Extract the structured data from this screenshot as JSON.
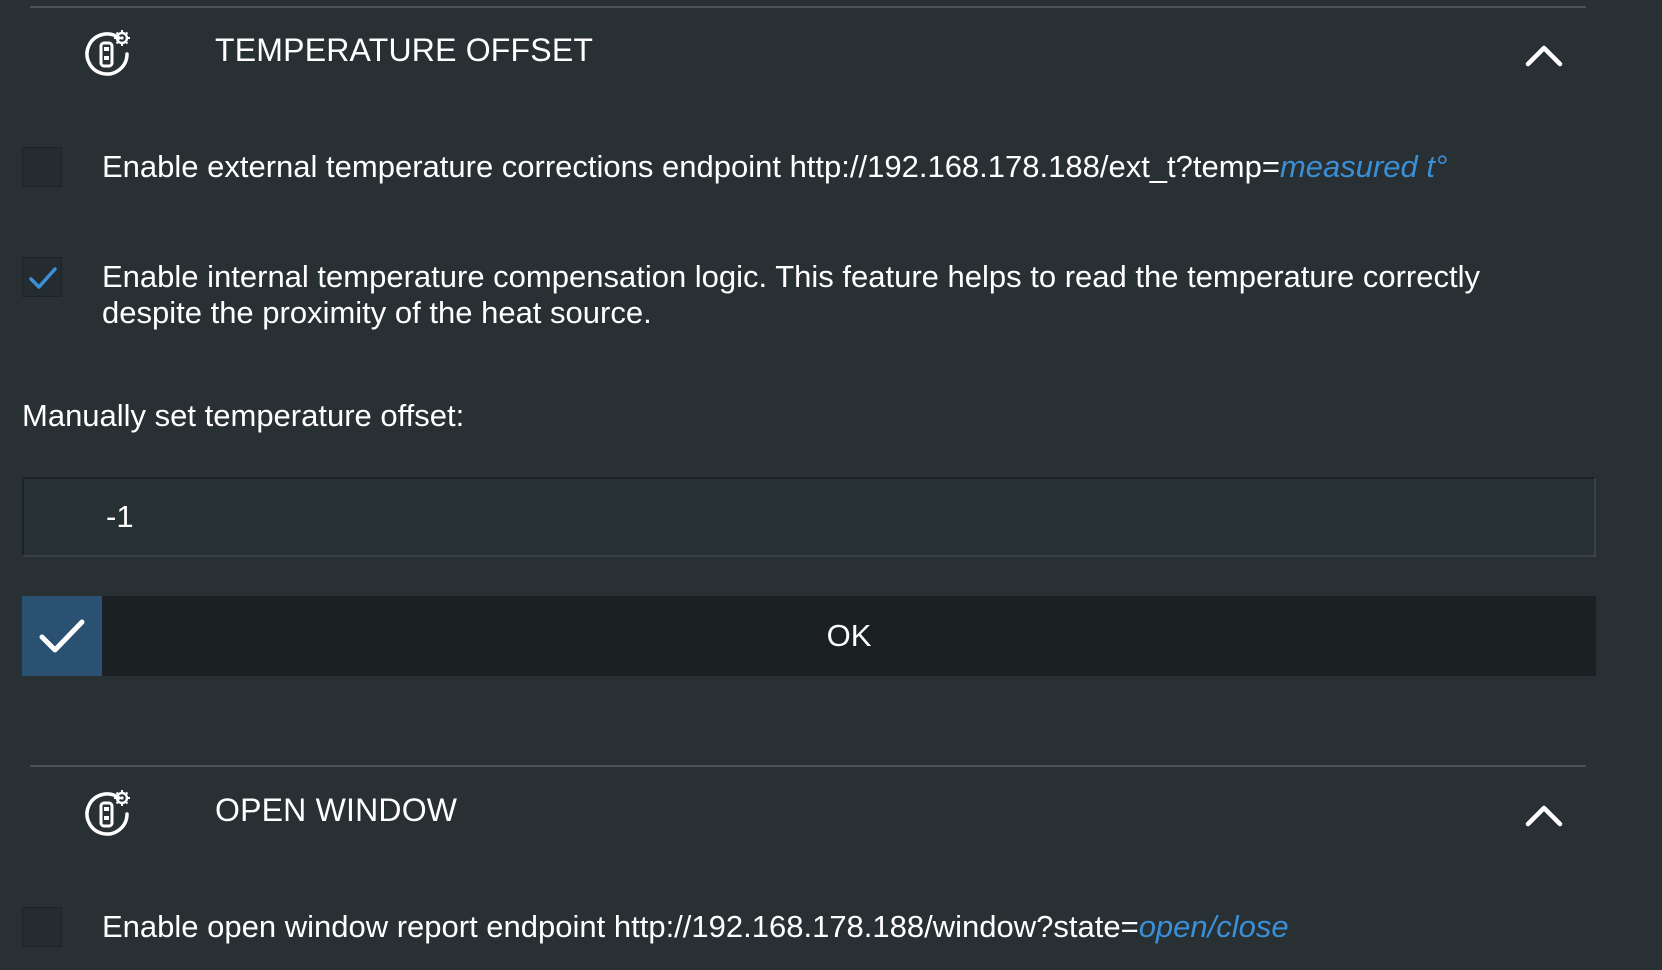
{
  "sections": {
    "temperature_offset": {
      "title": "TEMPERATURE OFFSET",
      "icon": "thermostat-settings-icon",
      "toggle_icon": "chevron-up-icon",
      "external_corrections": {
        "checked": false,
        "label_prefix": "Enable external temperature corrections endpoint http://192.168.178.188/ext_t?temp=",
        "param": "measured t°"
      },
      "internal_compensation": {
        "checked": true,
        "label": "Enable internal temperature compensation logic. This feature helps to read the temperature correctly despite the proximity of the heat source."
      },
      "manual_offset": {
        "label": "Manually set temperature offset:",
        "value": "-1"
      },
      "ok_button": {
        "label": "OK",
        "icon": "checkmark-icon"
      }
    },
    "open_window": {
      "title": "OPEN WINDOW",
      "icon": "thermostat-settings-icon",
      "toggle_icon": "chevron-up-icon",
      "report_endpoint": {
        "checked": false,
        "label_prefix": "Enable open window report endpoint http://192.168.178.188/window?state=",
        "param": "open/close"
      }
    }
  },
  "colors": {
    "background": "#293033",
    "accent_link": "#3a8fd6",
    "ok_check_bg": "#2a5072",
    "button_bg": "#1b2123"
  }
}
